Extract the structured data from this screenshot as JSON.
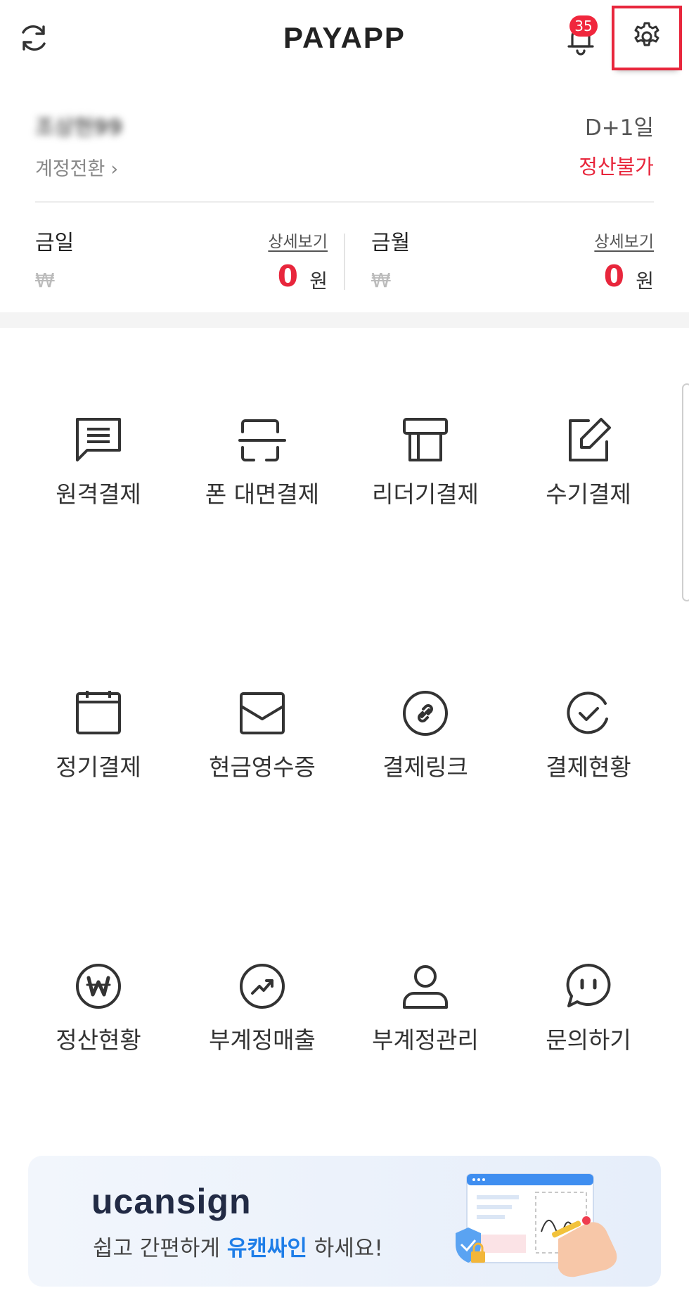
{
  "header": {
    "title": "PAYAPP",
    "notification_count": "35"
  },
  "account": {
    "name": "조상현99",
    "switch_label": "계정전환",
    "dday": "D+1일",
    "settlement_status": "정산불가"
  },
  "sales": {
    "today": {
      "label": "금일",
      "detail": "상세보기",
      "currency": "₩",
      "amount": "0",
      "unit": "원"
    },
    "month": {
      "label": "금월",
      "detail": "상세보기",
      "currency": "₩",
      "amount": "0",
      "unit": "원"
    }
  },
  "menu": [
    {
      "label": "원격결제",
      "icon": "message-icon"
    },
    {
      "label": "폰 대면결제",
      "icon": "scan-icon"
    },
    {
      "label": "리더기결제",
      "icon": "card-reader-icon"
    },
    {
      "label": "수기결제",
      "icon": "edit-icon"
    },
    {
      "label": "정기결제",
      "icon": "calendar-icon"
    },
    {
      "label": "현금영수증",
      "icon": "envelope-icon"
    },
    {
      "label": "결제링크",
      "icon": "link-icon"
    },
    {
      "label": "결제현황",
      "icon": "check-circle-icon"
    },
    {
      "label": "정산현황",
      "icon": "won-circle-icon"
    },
    {
      "label": "부계정매출",
      "icon": "trend-up-icon"
    },
    {
      "label": "부계정관리",
      "icon": "user-icon"
    },
    {
      "label": "문의하기",
      "icon": "chat-icon"
    }
  ],
  "banner": {
    "brand": "ucansign",
    "text_before": "쉽고 간편하게 ",
    "highlight": "유캔싸인",
    "text_after": " 하세요!"
  },
  "colors": {
    "accent_red": "#e8263c",
    "highlight_blue": "#1f7ee8"
  }
}
